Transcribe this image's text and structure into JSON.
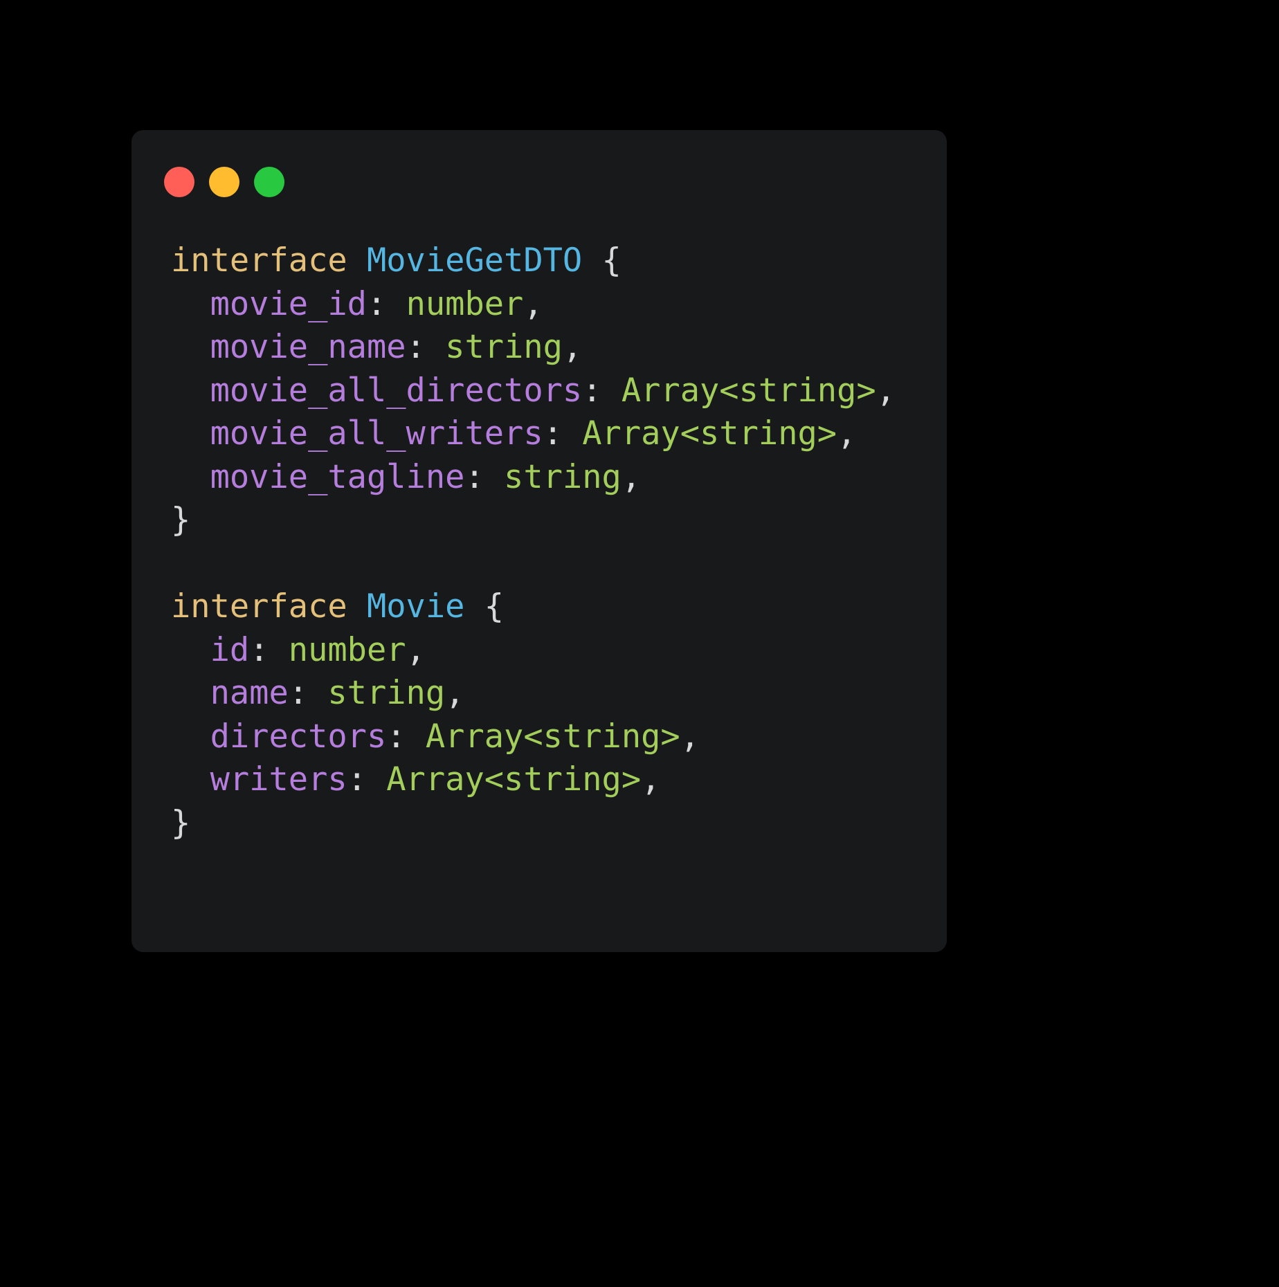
{
  "window": {
    "background_color": "#000000",
    "card_background": "#17191b",
    "controls": [
      {
        "name": "close",
        "color": "#ff5f56"
      },
      {
        "name": "minimize",
        "color": "#febc2e"
      },
      {
        "name": "maximize",
        "color": "#28c840"
      }
    ]
  },
  "theme": {
    "keyword": "#e5c07b",
    "type_name": "#56b6e2",
    "property": "#b57edc",
    "builtin_type": "#a3ce5b",
    "punctuation": "#d6d9da",
    "plain": "#d6d9da"
  },
  "code": {
    "language": "typescript",
    "plain_text": "interface MovieGetDTO {\n  movie_id: number,\n  movie_name: string,\n  movie_all_directors: Array<string>,\n  movie_all_writers: Array<string>,\n  movie_tagline: string,\n}\n\ninterface Movie {\n  id: number,\n  name: string,\n  directors: Array<string>,\n  writers: Array<string>,\n}",
    "lines": [
      {
        "tokens": [
          {
            "t": "interface",
            "c": "keyword"
          },
          {
            "t": " ",
            "c": "plain"
          },
          {
            "t": "MovieGetDTO",
            "c": "type_name"
          },
          {
            "t": " ",
            "c": "plain"
          },
          {
            "t": "{",
            "c": "punctuation"
          }
        ]
      },
      {
        "tokens": [
          {
            "t": "  ",
            "c": "plain"
          },
          {
            "t": "movie_id",
            "c": "property"
          },
          {
            "t": ":",
            "c": "punctuation"
          },
          {
            "t": " ",
            "c": "plain"
          },
          {
            "t": "number",
            "c": "builtin_type"
          },
          {
            "t": ",",
            "c": "punctuation"
          }
        ]
      },
      {
        "tokens": [
          {
            "t": "  ",
            "c": "plain"
          },
          {
            "t": "movie_name",
            "c": "property"
          },
          {
            "t": ":",
            "c": "punctuation"
          },
          {
            "t": " ",
            "c": "plain"
          },
          {
            "t": "string",
            "c": "builtin_type"
          },
          {
            "t": ",",
            "c": "punctuation"
          }
        ]
      },
      {
        "tokens": [
          {
            "t": "  ",
            "c": "plain"
          },
          {
            "t": "movie_all_directors",
            "c": "property"
          },
          {
            "t": ":",
            "c": "punctuation"
          },
          {
            "t": " ",
            "c": "plain"
          },
          {
            "t": "Array<string>",
            "c": "builtin_type"
          },
          {
            "t": ",",
            "c": "punctuation"
          }
        ]
      },
      {
        "tokens": [
          {
            "t": "  ",
            "c": "plain"
          },
          {
            "t": "movie_all_writers",
            "c": "property"
          },
          {
            "t": ":",
            "c": "punctuation"
          },
          {
            "t": " ",
            "c": "plain"
          },
          {
            "t": "Array<string>",
            "c": "builtin_type"
          },
          {
            "t": ",",
            "c": "punctuation"
          }
        ]
      },
      {
        "tokens": [
          {
            "t": "  ",
            "c": "plain"
          },
          {
            "t": "movie_tagline",
            "c": "property"
          },
          {
            "t": ":",
            "c": "punctuation"
          },
          {
            "t": " ",
            "c": "plain"
          },
          {
            "t": "string",
            "c": "builtin_type"
          },
          {
            "t": ",",
            "c": "punctuation"
          }
        ]
      },
      {
        "tokens": [
          {
            "t": "}",
            "c": "punctuation"
          }
        ]
      },
      {
        "tokens": []
      },
      {
        "tokens": [
          {
            "t": "interface",
            "c": "keyword"
          },
          {
            "t": " ",
            "c": "plain"
          },
          {
            "t": "Movie",
            "c": "type_name"
          },
          {
            "t": " ",
            "c": "plain"
          },
          {
            "t": "{",
            "c": "punctuation"
          }
        ]
      },
      {
        "tokens": [
          {
            "t": "  ",
            "c": "plain"
          },
          {
            "t": "id",
            "c": "property"
          },
          {
            "t": ":",
            "c": "punctuation"
          },
          {
            "t": " ",
            "c": "plain"
          },
          {
            "t": "number",
            "c": "builtin_type"
          },
          {
            "t": ",",
            "c": "punctuation"
          }
        ]
      },
      {
        "tokens": [
          {
            "t": "  ",
            "c": "plain"
          },
          {
            "t": "name",
            "c": "property"
          },
          {
            "t": ":",
            "c": "punctuation"
          },
          {
            "t": " ",
            "c": "plain"
          },
          {
            "t": "string",
            "c": "builtin_type"
          },
          {
            "t": ",",
            "c": "punctuation"
          }
        ]
      },
      {
        "tokens": [
          {
            "t": "  ",
            "c": "plain"
          },
          {
            "t": "directors",
            "c": "property"
          },
          {
            "t": ":",
            "c": "punctuation"
          },
          {
            "t": " ",
            "c": "plain"
          },
          {
            "t": "Array<string>",
            "c": "builtin_type"
          },
          {
            "t": ",",
            "c": "punctuation"
          }
        ]
      },
      {
        "tokens": [
          {
            "t": "  ",
            "c": "plain"
          },
          {
            "t": "writers",
            "c": "property"
          },
          {
            "t": ":",
            "c": "punctuation"
          },
          {
            "t": " ",
            "c": "plain"
          },
          {
            "t": "Array<string>",
            "c": "builtin_type"
          },
          {
            "t": ",",
            "c": "punctuation"
          }
        ]
      },
      {
        "tokens": [
          {
            "t": "}",
            "c": "punctuation"
          }
        ]
      }
    ]
  }
}
